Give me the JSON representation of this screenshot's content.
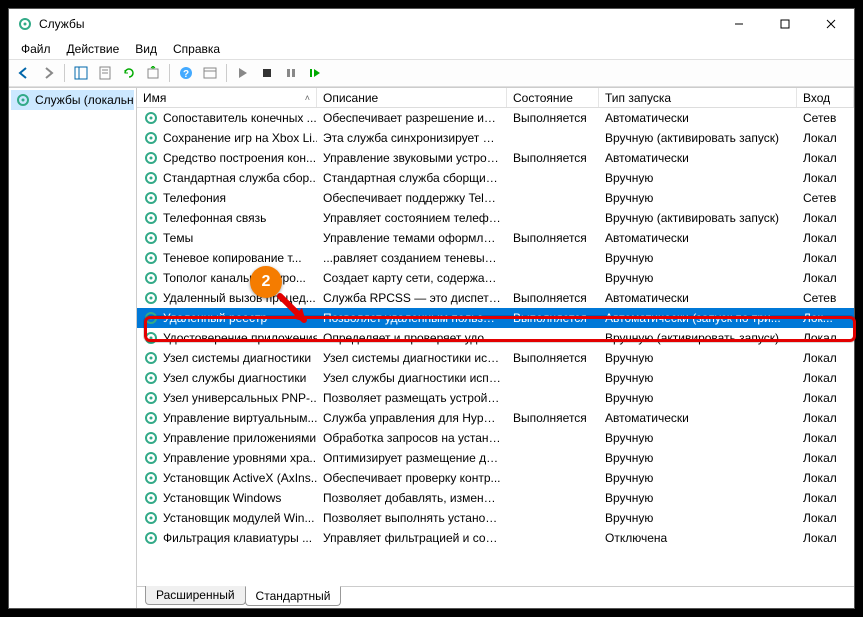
{
  "window": {
    "title": "Службы"
  },
  "menu": {
    "file": "Файл",
    "action": "Действие",
    "view": "Вид",
    "help": "Справка"
  },
  "sidebar": {
    "node": "Службы (локальные)"
  },
  "columns": {
    "name": "Имя",
    "desc": "Описание",
    "state": "Состояние",
    "start": "Тип запуска",
    "logon": "Вход"
  },
  "tabs": {
    "extended": "Расширенный",
    "standard": "Стандартный"
  },
  "callout": {
    "number": "2"
  },
  "services": [
    {
      "name": "Сопоставитель конечных ...",
      "desc": "Обеспечивает разрешение иде...",
      "state": "Выполняется",
      "start": "Автоматически",
      "logon": "Сетев"
    },
    {
      "name": "Сохранение игр на Xbox Li...",
      "desc": "Эта служба синхронизирует да...",
      "state": "",
      "start": "Вручную (активировать запуск)",
      "logon": "Локал"
    },
    {
      "name": "Средство построения кон...",
      "desc": "Управление звуковыми устрой...",
      "state": "Выполняется",
      "start": "Автоматически",
      "logon": "Локал"
    },
    {
      "name": "Стандартная служба сбор...",
      "desc": "Стандартная служба сборщика...",
      "state": "",
      "start": "Вручную",
      "logon": "Локал"
    },
    {
      "name": "Телефония",
      "desc": "Обеспечивает поддержку Telep...",
      "state": "",
      "start": "Вручную",
      "logon": "Сетев"
    },
    {
      "name": "Телефонная связь",
      "desc": "Управляет состоянием телефо...",
      "state": "",
      "start": "Вручную (активировать запуск)",
      "logon": "Локал"
    },
    {
      "name": "Темы",
      "desc": "Управление темами оформлен...",
      "state": "Выполняется",
      "start": "Автоматически",
      "logon": "Локал"
    },
    {
      "name": "Теневое копирование т...",
      "desc": "...равляет созданием теневых ...",
      "state": "",
      "start": "Вручную",
      "logon": "Локал"
    },
    {
      "name": "Тополог канального уро...",
      "desc": "Создает карту сети, содержащу...",
      "state": "",
      "start": "Вручную",
      "logon": "Локал"
    },
    {
      "name": "Удаленный вызов процед...",
      "desc": "Служба RPCSS — это диспетче...",
      "state": "Выполняется",
      "start": "Автоматически",
      "logon": "Сетев"
    },
    {
      "name": "Удаленный реестр",
      "desc": "Позволяет удаленным пользов...",
      "state": "Выполняется",
      "start": "Автоматически (запуск по три...",
      "logon": "Лок...",
      "selected": true
    },
    {
      "name": "Удостоверение приложения",
      "desc": "Определяет и проверяет удост...",
      "state": "",
      "start": "Вручную (активировать запуск)",
      "logon": "Локал"
    },
    {
      "name": "Узел системы диагностики",
      "desc": "Узел системы диагностики исп...",
      "state": "Выполняется",
      "start": "Вручную",
      "logon": "Локал"
    },
    {
      "name": "Узел службы диагностики",
      "desc": "Узел службы диагностики испо...",
      "state": "",
      "start": "Вручную",
      "logon": "Локал"
    },
    {
      "name": "Узел универсальных PNP-...",
      "desc": "Позволяет размещать устройст...",
      "state": "",
      "start": "Вручную",
      "logon": "Локал"
    },
    {
      "name": "Управление виртуальным...",
      "desc": "Служба управления для Hyper-...",
      "state": "Выполняется",
      "start": "Автоматически",
      "logon": "Локал"
    },
    {
      "name": "Управление приложениями",
      "desc": "Обработка запросов на устано...",
      "state": "",
      "start": "Вручную",
      "logon": "Локал"
    },
    {
      "name": "Управление уровнями хра...",
      "desc": "Оптимизирует размещение да...",
      "state": "",
      "start": "Вручную",
      "logon": "Локал"
    },
    {
      "name": "Установщик ActiveX (AxIns...",
      "desc": "Обеспечивает проверку контр...",
      "state": "",
      "start": "Вручную",
      "logon": "Локал"
    },
    {
      "name": "Установщик Windows",
      "desc": "Позволяет добавлять, изменят...",
      "state": "",
      "start": "Вручную",
      "logon": "Локал"
    },
    {
      "name": "Установщик модулей Win...",
      "desc": "Позволяет выполнять установк...",
      "state": "",
      "start": "Вручную",
      "logon": "Локал"
    },
    {
      "name": "Фильтрация клавиатуры ...",
      "desc": "Управляет фильтрацией и сопо...",
      "state": "",
      "start": "Отключена",
      "logon": "Локал"
    }
  ]
}
